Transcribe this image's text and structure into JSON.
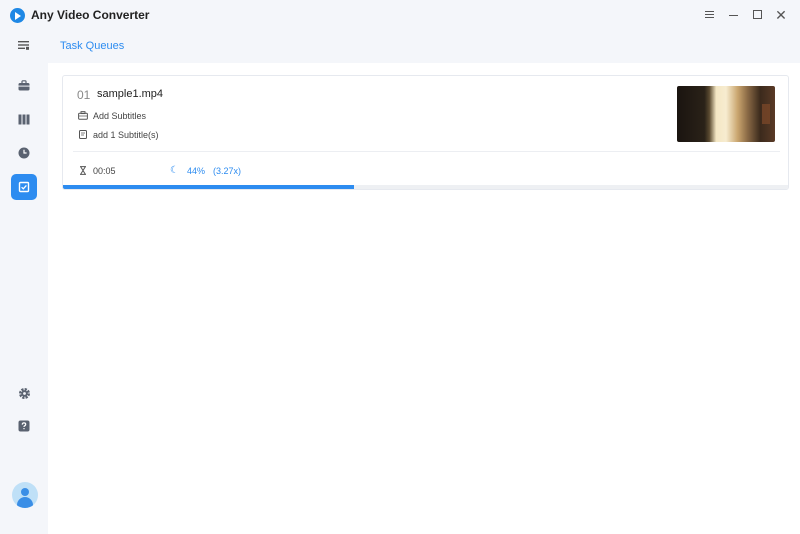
{
  "app": {
    "title": "Any Video Converter"
  },
  "window_controls": {
    "close_glyph": "✕"
  },
  "sidebar": {
    "items": [
      {
        "name": "menu-toggle",
        "icon": "menu-icon"
      },
      {
        "name": "convert",
        "icon": "toolbox-icon"
      },
      {
        "name": "edit",
        "icon": "columns-icon"
      },
      {
        "name": "history",
        "icon": "clock-icon"
      },
      {
        "name": "task-queues",
        "icon": "task-icon",
        "active": true
      },
      {
        "name": "settings",
        "icon": "gear-icon"
      },
      {
        "name": "help",
        "icon": "help-icon"
      }
    ],
    "accent": "#2d8cf0"
  },
  "header": {
    "title": "Task Queues"
  },
  "task": {
    "index": "01",
    "filename": "sample1.mp4",
    "subtitle_action": "Add Subtitles",
    "subtitle_info": "add 1 Subtitle(s)",
    "elapsed": "00:05",
    "spinner_glyph": "☾",
    "progress_label": "44%",
    "progress_fraction": 0.4,
    "speed": "(3.27x)"
  }
}
